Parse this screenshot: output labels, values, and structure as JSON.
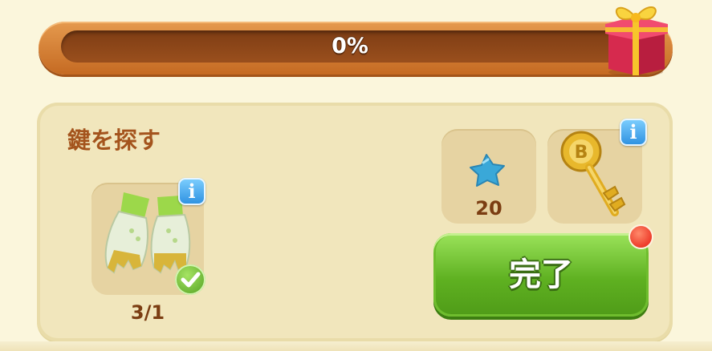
{
  "progress": {
    "label": "0%",
    "value": 0.0
  },
  "task": {
    "title": "鍵を探す",
    "required_item": {
      "name": "gloves",
      "count": "3/1",
      "complete": true
    }
  },
  "rewards": [
    {
      "name": "blue-star",
      "amount": "20"
    },
    {
      "name": "golden-key"
    }
  ],
  "actions": {
    "done_label": "完了"
  },
  "colors": {
    "accent_green": "#5fb121",
    "progress_orange": "#d9823a",
    "title_brown": "#a4541d",
    "info_blue": "#2b8fe0"
  },
  "icons": [
    "gift-icon",
    "gloves-icon",
    "info-icon",
    "check-icon",
    "star-icon",
    "key-icon",
    "notification-dot"
  ]
}
